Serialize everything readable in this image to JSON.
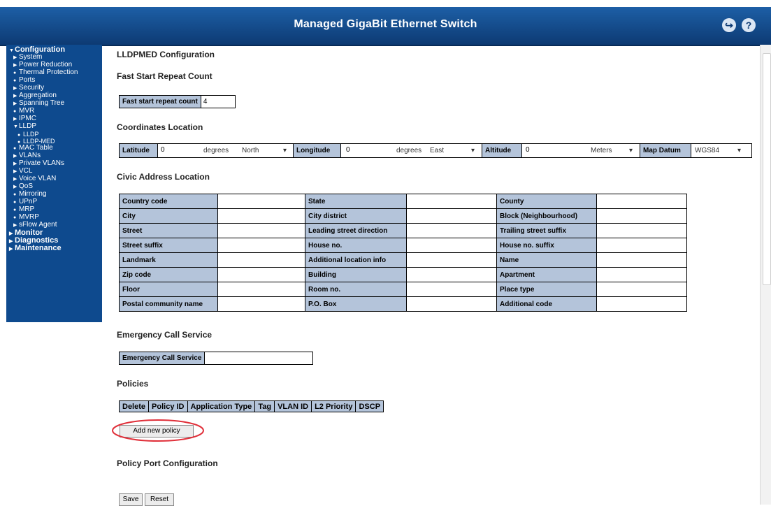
{
  "header": {
    "title": "Managed GigaBit Ethernet Switch"
  },
  "sidebar": {
    "configuration": "Configuration",
    "items": [
      "System",
      "Power Reduction",
      "Thermal Protection",
      "Ports",
      "Security",
      "Aggregation",
      "Spanning Tree",
      "MVR",
      "IPMC",
      "LLDP"
    ],
    "lldp_sub": [
      "LLDP",
      "LLDP-MED"
    ],
    "items2": [
      "MAC Table",
      "VLANs",
      "Private VLANs",
      "VCL",
      "Voice VLAN",
      "QoS",
      "Mirroring",
      "UPnP",
      "MRP",
      "MVRP",
      "sFlow Agent"
    ],
    "monitor": "Monitor",
    "diagnostics": "Diagnostics",
    "maintenance": "Maintenance"
  },
  "page": {
    "title": "LLDPMED Configuration",
    "fast_start_heading": "Fast Start Repeat Count",
    "fast_start_label": "Fast start repeat count",
    "fast_start_value": "4",
    "coords_heading": "Coordinates Location",
    "latitude_label": "Latitude",
    "latitude_value": "0",
    "latitude_unit": "degrees",
    "latitude_dir": "North",
    "longitude_label": "Longitude",
    "longitude_value": "0",
    "longitude_unit": "degrees",
    "longitude_dir": "East",
    "altitude_label": "Altitude",
    "altitude_value": "0",
    "altitude_unit": "Meters",
    "datum_label": "Map Datum",
    "datum_value": "WGS84",
    "civic_heading": "Civic Address Location",
    "civic_rows": [
      [
        "Country code",
        "State",
        "County"
      ],
      [
        "City",
        "City district",
        "Block (Neighbourhood)"
      ],
      [
        "Street",
        "Leading street direction",
        "Trailing street suffix"
      ],
      [
        "Street suffix",
        "House no.",
        "House no. suffix"
      ],
      [
        "Landmark",
        "Additional location info",
        "Name"
      ],
      [
        "Zip code",
        "Building",
        "Apartment"
      ],
      [
        "Floor",
        "Room no.",
        "Place type"
      ],
      [
        "Postal community name",
        "P.O. Box",
        "Additional code"
      ]
    ],
    "ecs_heading": "Emergency Call Service",
    "ecs_label": "Emergency Call Service",
    "policies_heading": "Policies",
    "policy_columns": [
      "Delete",
      "Policy ID",
      "Application Type",
      "Tag",
      "VLAN ID",
      "L2 Priority",
      "DSCP"
    ],
    "add_policy_label": "Add new policy",
    "ppc_heading": "Policy Port Configuration",
    "save_label": "Save",
    "reset_label": "Reset"
  },
  "colors": {
    "header": "#0d3a73",
    "sidebar": "#0e4a8e",
    "table_header": "#b4c4da",
    "highlight_circle": "#e0303a"
  }
}
